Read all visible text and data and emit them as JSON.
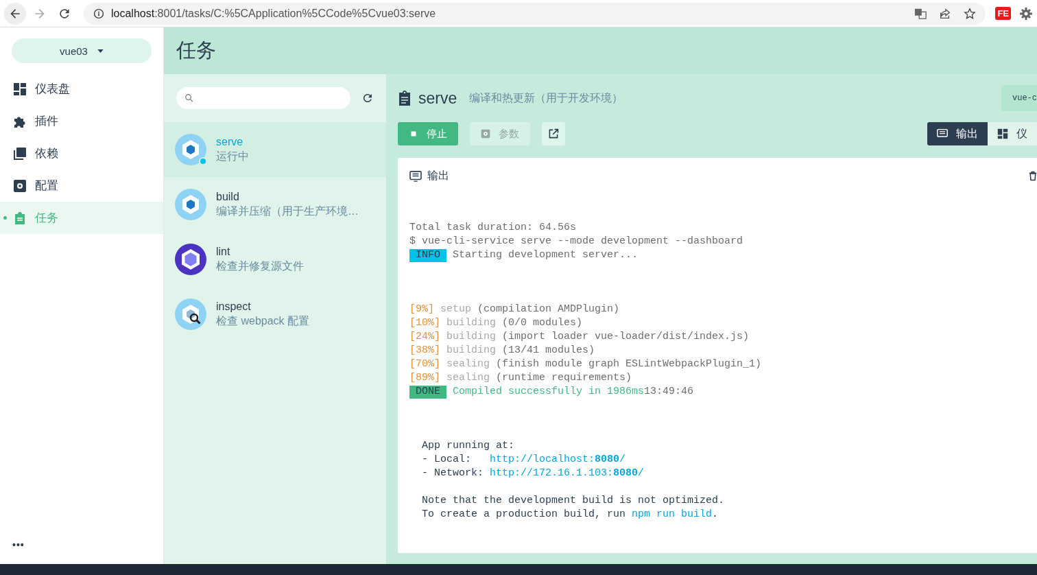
{
  "browser": {
    "url_host": "localhost",
    "url_path": ":8001/tasks/C:%5CApplication%5CCode%5Cvue03:serve",
    "extension_label": "FE"
  },
  "project_selector": {
    "label": "vue03"
  },
  "page_title": "任务",
  "nav": [
    {
      "label": "仪表盘",
      "selected": false
    },
    {
      "label": "插件",
      "selected": false
    },
    {
      "label": "依赖",
      "selected": false
    },
    {
      "label": "配置",
      "selected": false
    },
    {
      "label": "任务",
      "selected": true
    }
  ],
  "more_label": "•••",
  "tasks": [
    {
      "name": "serve",
      "description": "运行中",
      "selected": true,
      "running": true
    },
    {
      "name": "build",
      "description": "编译并压缩（用于生产环境…",
      "selected": false,
      "running": false
    },
    {
      "name": "lint",
      "description": "检查并修复源文件",
      "selected": false,
      "running": false
    },
    {
      "name": "inspect",
      "description": "检查 webpack 配置",
      "selected": false,
      "running": false
    }
  ],
  "task_detail": {
    "name": "serve",
    "description": "编译和热更新（用于开发环境）",
    "command_badge": "vue-c",
    "buttons": [
      {
        "label": "停止",
        "kind": "primary",
        "disabled": false
      },
      {
        "label": "参数",
        "kind": "secondary",
        "disabled": true
      },
      {
        "kind": "icon"
      }
    ],
    "view_tabs": [
      {
        "label": "输出",
        "selected": true
      },
      {
        "label": "仪",
        "selected": false
      }
    ],
    "output_title": "输出",
    "log_blocks": [
      [
        {
          "segments": [
            {
              "text": "Total task duration: 64.56s",
              "kind": "plain"
            }
          ]
        },
        {
          "segments": [
            {
              "text": "$ vue-cli-service serve --mode development --dashboard",
              "kind": "plain"
            }
          ]
        },
        {
          "segments": [
            {
              "text": " INFO ",
              "kind": "info"
            },
            {
              "text": " Starting development server...",
              "kind": "plain"
            }
          ]
        }
      ],
      [
        {
          "segments": [
            {
              "text": "[9%]",
              "kind": "percent"
            },
            {
              "text": " setup",
              "kind": "faint"
            },
            {
              "text": " (compilation AMDPlugin)",
              "kind": "plain"
            }
          ]
        },
        {
          "segments": [
            {
              "text": "[10%]",
              "kind": "percent"
            },
            {
              "text": " building",
              "kind": "faint"
            },
            {
              "text": " (0/0 modules)",
              "kind": "plain"
            }
          ]
        },
        {
          "segments": [
            {
              "text": "[24%]",
              "kind": "percent"
            },
            {
              "text": " building",
              "kind": "faint"
            },
            {
              "text": " (import loader vue-loader/dist/index.js)",
              "kind": "plain"
            }
          ]
        },
        {
          "segments": [
            {
              "text": "[38%]",
              "kind": "percent"
            },
            {
              "text": " building",
              "kind": "faint"
            },
            {
              "text": " (13/41 modules)",
              "kind": "plain"
            }
          ]
        },
        {
          "segments": [
            {
              "text": "[70%]",
              "kind": "percent"
            },
            {
              "text": " sealing",
              "kind": "faint"
            },
            {
              "text": " (finish module graph ESLintWebpackPlugin_1)",
              "kind": "plain"
            }
          ]
        },
        {
          "segments": [
            {
              "text": "[89%]",
              "kind": "percent"
            },
            {
              "text": " sealing",
              "kind": "faint"
            },
            {
              "text": " (runtime requirements)",
              "kind": "plain"
            }
          ]
        },
        {
          "segments": [
            {
              "text": " DONE ",
              "kind": "done"
            },
            {
              "text": " Compiled successfully in 1986ms",
              "kind": "success"
            },
            {
              "text": "13:49:46",
              "kind": "plain"
            }
          ]
        }
      ],
      [
        {
          "segments": [
            {
              "text": "  App running at:",
              "kind": "dark"
            }
          ]
        },
        {
          "segments": [
            {
              "text": "  - Local:   ",
              "kind": "dark"
            },
            {
              "text": "http://localhost:",
              "kind": "link"
            },
            {
              "text": "8080",
              "kind": "link-bold"
            },
            {
              "text": "/",
              "kind": "link"
            }
          ]
        },
        {
          "segments": [
            {
              "text": "  - Network: ",
              "kind": "dark"
            },
            {
              "text": "http://172.16.1.103:",
              "kind": "link"
            },
            {
              "text": "8080",
              "kind": "link-bold"
            },
            {
              "text": "/",
              "kind": "link"
            }
          ]
        }
      ],
      [
        {
          "segments": [
            {
              "text": "  Note that the development build is not optimized.",
              "kind": "dark"
            }
          ]
        },
        {
          "segments": [
            {
              "text": "  To create a production build, run ",
              "kind": "dark"
            },
            {
              "text": "npm run build",
              "kind": "link"
            },
            {
              "text": ".",
              "kind": "dark"
            }
          ]
        }
      ]
    ]
  }
}
